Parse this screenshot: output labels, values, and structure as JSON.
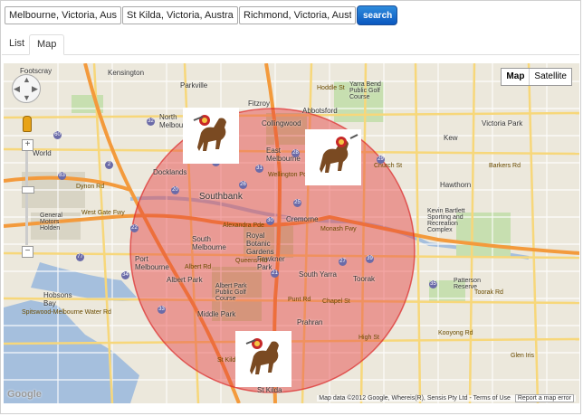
{
  "search": {
    "locations": [
      "Melbourne, Victoria, Australia",
      "St Kilda, Victoria, Australia",
      "Richmond, Victoria, Australia"
    ],
    "button_label": "search"
  },
  "tabs": {
    "list_label": "List",
    "map_label": "Map",
    "active": "Map"
  },
  "map": {
    "map_type_options": [
      "Map",
      "Satellite"
    ],
    "selected_map_type": "Map",
    "zoom_plus": "+",
    "zoom_minus": "−",
    "logo": "Google",
    "attribution": "Map data ©2012 Google, Whereis(R), Sensis Pty Ltd",
    "terms_label": "Terms of Use",
    "report_label": "Report a map error",
    "circle_color": "#e23b3b",
    "marker_icon": "horse-icon",
    "place_labels": {
      "footscray": "Footscray",
      "kensington": "Kensington",
      "parkville": "Parkville",
      "fitzroy": "Fitzroy",
      "north_melbourne": "North Melbourne",
      "collingwood": "Collingwood",
      "abbotsford": "Abbotsford",
      "east_melbourne": "East Melbourne",
      "docklands": "Docklands",
      "southbank": "Southbank",
      "cremorne": "Cremorne",
      "south_melbourne": "South Melbourne",
      "port_melbourne": "Port Melbourne",
      "royal_botanic": "Royal Botanic Gardens",
      "fawkner": "Fawkner Park",
      "south_yarra": "South Yarra",
      "toorak": "Toorak",
      "albert_park": "Albert Park",
      "middle_park": "Middle Park",
      "prahran": "Prahran",
      "st_kilda": "St Kilda",
      "kew": "Kew",
      "hawthorn": "Hawthorn",
      "hobsons_bay": "Hobsons Bay",
      "yarra_bend": "Yarra Bend Public Golf Course",
      "kevin_bartlett": "Kevin Bartlett Sporting and Recreation Complex",
      "patterson_reserve": "Patterson Reserve",
      "albert_park_golf": "Albert Park Public Golf Course",
      "victoria_park": "Victoria Park",
      "world": "World",
      "general_motors": "General Motors Holden"
    },
    "road_labels": {
      "westgate": "West Gate Fwy",
      "monash": "Monash Fwy",
      "dynon": "Dynon Rd",
      "punt": "Punt Rd",
      "barkers": "Barkers Rd",
      "toorak_rd": "Toorak Rd",
      "kooyong": "Kooyong Rd",
      "queens": "Queens Rd",
      "church": "Church St",
      "wellington": "Wellington Pde",
      "alexandra": "Alexandra Pde",
      "hoddle": "Hoddle St",
      "high": "High St",
      "glen_iris": "Glen Iris",
      "spitswood": "Spitswood-Melbourne Water Rd",
      "st_kilda_rd": "St Kilda Rd",
      "albert_rd": "Albert Rd",
      "chapel": "Chapel St"
    },
    "route_shields": [
      "2",
      "32",
      "20",
      "22",
      "29",
      "25",
      "26",
      "27",
      "30",
      "33",
      "83",
      "34",
      "28",
      "31",
      "39",
      "24",
      "21",
      "35",
      "60",
      "77"
    ]
  }
}
